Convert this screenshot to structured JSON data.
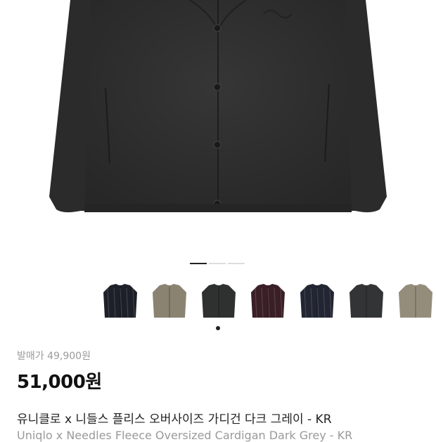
{
  "product": {
    "release_price_label": "발매가 49,900원",
    "price": "51,000원",
    "name_ko": "유니클로 x 니들스 플리스 오버사이즈 가디건 다크 그레이 - KR",
    "name_en": "Uniqlo x Needles Fleece Oversized Cardigan Dark Grey - KR"
  },
  "gallery": {
    "slide_count": 3,
    "active_slide": 1,
    "main_color": "#2e2f2e"
  },
  "variants": [
    {
      "color": "#1e2029",
      "pattern": "stripe"
    },
    {
      "color": "#8a8372",
      "pattern": "solid"
    },
    {
      "color": "#2f3030",
      "pattern": "solid"
    },
    {
      "color": "#3a1f27",
      "pattern": "stripe"
    },
    {
      "color": "#222532",
      "pattern": "stripe"
    },
    {
      "color": "#333435",
      "pattern": "solid"
    },
    {
      "color": "#958d7b",
      "pattern": "solid"
    }
  ],
  "selected_variant": 3
}
